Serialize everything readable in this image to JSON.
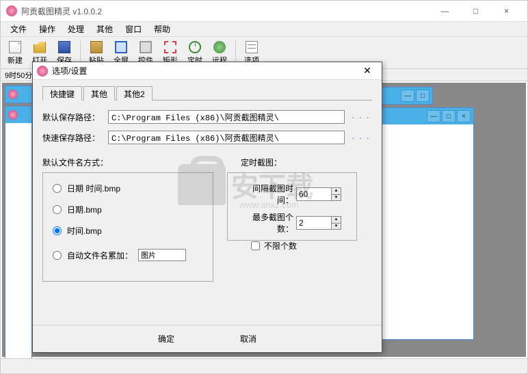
{
  "window": {
    "title": "阿贡截图精灵  v1.0.0.2",
    "min_icon": "—",
    "max_icon": "□",
    "close_icon": "×"
  },
  "menu": {
    "file": "文件",
    "operate": "操作",
    "process": "处理",
    "other": "其他",
    "window": "窗口",
    "help": "帮助"
  },
  "toolbar": {
    "new": "新建",
    "open": "打开",
    "save": "保存",
    "paste": "粘贴",
    "fullscreen": "全屏",
    "control": "控件",
    "rect": "矩形",
    "timer": "定时",
    "remote": "远程",
    "options": "选项"
  },
  "status_time": "9时50分",
  "dialog": {
    "title": "选项/设置",
    "close": "✕",
    "tabs": {
      "hotkey": "快捷键",
      "other": "其他",
      "other2": "其他2"
    },
    "path_default_label": "默认保存路径：",
    "path_default_value": "C:\\Program Files (x86)\\阿贡截图精灵\\",
    "path_quick_label": "快速保存路径：",
    "path_quick_value": "C:\\Program Files (x86)\\阿贡截图精灵\\",
    "path_browse": ". . .",
    "filename_section": "默认文件名方式：",
    "timer_section": "定时截图：",
    "radio_datetime": "日期 时间.bmp",
    "radio_date": "日期.bmp",
    "radio_time": "时间.bmp",
    "radio_auto": "自动文件名累加：",
    "auto_value": "图片",
    "interval_label": "间隔截图时间：",
    "interval_value": "60",
    "maxcount_label": "最多截图个数：",
    "maxcount_value": "2",
    "unlimited": "不限个数",
    "ok": "确定",
    "cancel": "取消"
  },
  "watermark": {
    "text": "安下载",
    "url": "www.anxz.com"
  }
}
